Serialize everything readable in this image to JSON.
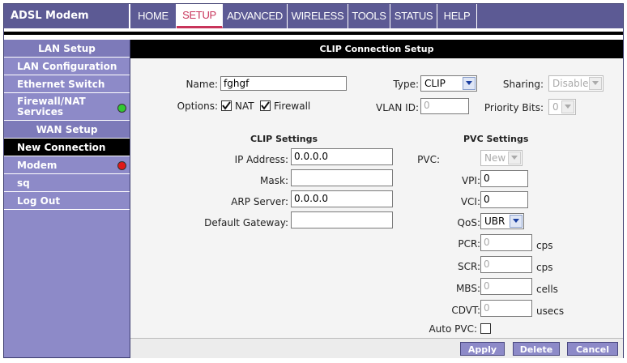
{
  "app": {
    "brand": "ADSL Modem"
  },
  "topnav": [
    "HOME",
    "SETUP",
    "ADVANCED",
    "WIRELESS",
    "TOOLS",
    "STATUS",
    "HELP"
  ],
  "sidebar": {
    "lan_header": "LAN Setup",
    "lan_configuration": "LAN Configuration",
    "ethernet_switch": "Ethernet Switch",
    "firewall_line1": "Firewall/NAT",
    "firewall_line2": "Services",
    "wan_header": "WAN Setup",
    "new_connection": "New Connection",
    "modem": "Modem",
    "sq": "sq",
    "logout": "Log Out",
    "status_colors": {
      "firewall": "#32c832",
      "modem": "#e01818"
    }
  },
  "page": {
    "title": "CLIP Connection Setup",
    "name_label": "Name:",
    "name_value": "fghgf",
    "type_label": "Type:",
    "type_value": "CLIP",
    "sharing_label": "Sharing:",
    "sharing_value": "Disable",
    "options_label": "Options:",
    "nat_label": "NAT",
    "firewall_label": "Firewall",
    "vlan_label": "VLAN ID:",
    "vlan_value": "0",
    "priority_label": "Priority Bits:",
    "priority_value": "0"
  },
  "clip": {
    "title": "CLIP Settings",
    "ip_label": "IP Address:",
    "ip_value": "0.0.0.0",
    "mask_label": "Mask:",
    "mask_value": "",
    "arp_label": "ARP Server:",
    "arp_value": "0.0.0.0",
    "gateway_label": "Default Gateway:",
    "gateway_value": ""
  },
  "pvc": {
    "title": "PVC Settings",
    "pvc_label": "PVC:",
    "pvc_value": "New",
    "vpi_label": "VPI:",
    "vpi_value": "0",
    "vci_label": "VCI:",
    "vci_value": "0",
    "qos_label": "QoS:",
    "qos_value": "UBR",
    "pcr_label": "PCR:",
    "pcr_value": "0",
    "pcr_unit": "cps",
    "scr_label": "SCR:",
    "scr_value": "0",
    "scr_unit": "cps",
    "mbs_label": "MBS:",
    "mbs_value": "0",
    "mbs_unit": "cells",
    "cdvt_label": "CDVT:",
    "cdvt_value": "0",
    "cdvt_unit": "usecs",
    "autopvc_label": "Auto PVC:"
  },
  "buttons": {
    "apply": "Apply",
    "delete": "Delete",
    "cancel": "Cancel"
  }
}
